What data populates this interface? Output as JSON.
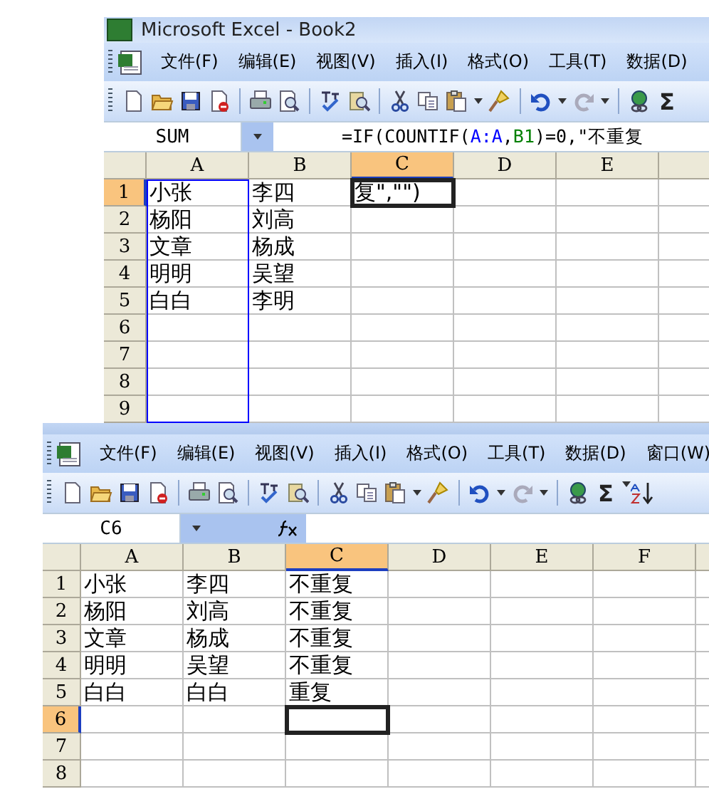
{
  "windows": [
    {
      "title": "Microsoft Excel - Book2",
      "menus": [
        "文件(F)",
        "编辑(E)",
        "视图(V)",
        "插入(I)",
        "格式(O)",
        "工具(T)",
        "数据(D)"
      ],
      "sum_label": "Σ",
      "name_box": "SUM",
      "formula": [
        {
          "text": "=IF(COUNTIF("
        },
        {
          "text": "A:A",
          "color": "#0000ff"
        },
        {
          "text": ","
        },
        {
          "text": "B1",
          "color": "#008000"
        },
        {
          "text": ")=0,\"不重复"
        }
      ],
      "columns": [
        {
          "label": "A",
          "selected": false,
          "color": "#0000ff"
        },
        {
          "label": "B",
          "selected": false
        },
        {
          "label": "C",
          "selected": true
        },
        {
          "label": "D",
          "selected": false
        },
        {
          "label": "E",
          "selected": false
        }
      ],
      "rows": [
        {
          "header": "1",
          "selected": true,
          "cells": [
            "小张",
            "李四",
            "复\",\"\")"
          ]
        },
        {
          "header": "2",
          "selected": false,
          "cells": [
            "杨阳",
            "刘高"
          ]
        },
        {
          "header": "3",
          "selected": false,
          "cells": [
            "文章",
            "杨成"
          ]
        },
        {
          "header": "4",
          "selected": false,
          "cells": [
            "明明",
            "吴望"
          ]
        },
        {
          "header": "5",
          "selected": false,
          "cells": [
            "白白",
            "李明"
          ]
        },
        {
          "header": "6",
          "selected": false,
          "cells": []
        },
        {
          "header": "7",
          "selected": false,
          "cells": []
        },
        {
          "header": "8",
          "selected": false,
          "cells": []
        },
        {
          "header": "9",
          "selected": false,
          "cells": []
        }
      ]
    },
    {
      "menus": [
        "文件(F)",
        "编辑(E)",
        "视图(V)",
        "插入(I)",
        "格式(O)",
        "工具(T)",
        "数据(D)",
        "窗口(W)"
      ],
      "sum_label": "Σ",
      "name_box": "C6",
      "columns": [
        {
          "label": "A",
          "selected": false
        },
        {
          "label": "B",
          "selected": false
        },
        {
          "label": "C",
          "selected": true
        },
        {
          "label": "D",
          "selected": false
        },
        {
          "label": "E",
          "selected": false
        },
        {
          "label": "F",
          "selected": false
        }
      ],
      "rows": [
        {
          "header": "1",
          "selected": false,
          "cells": [
            "小张",
            "李四",
            "不重复"
          ]
        },
        {
          "header": "2",
          "selected": false,
          "cells": [
            "杨阳",
            "刘高",
            "不重复"
          ]
        },
        {
          "header": "3",
          "selected": false,
          "cells": [
            "文章",
            "杨成",
            "不重复"
          ]
        },
        {
          "header": "4",
          "selected": false,
          "cells": [
            "明明",
            "吴望",
            "不重复"
          ]
        },
        {
          "header": "5",
          "selected": false,
          "cells": [
            "白白",
            "白白",
            "重复"
          ]
        },
        {
          "header": "6",
          "selected": true,
          "cells": []
        },
        {
          "header": "7",
          "selected": false,
          "cells": []
        },
        {
          "header": "8",
          "selected": false,
          "cells": []
        }
      ]
    }
  ]
}
